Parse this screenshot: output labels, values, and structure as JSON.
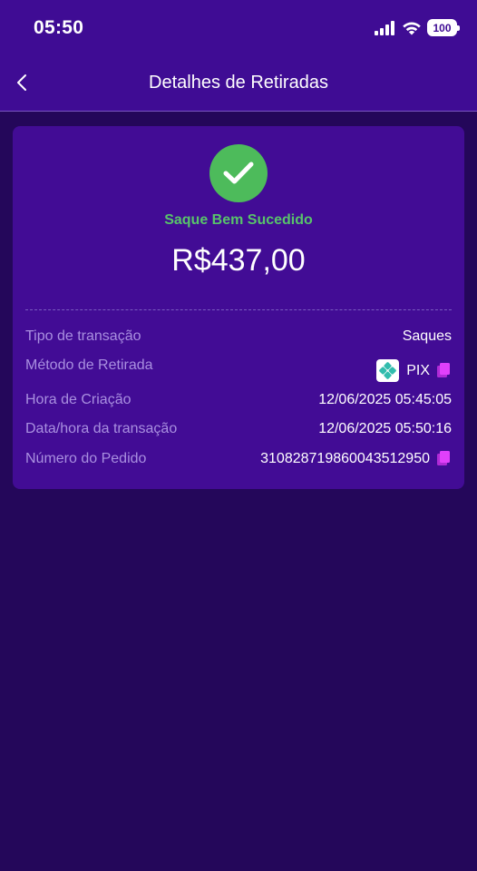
{
  "status_bar": {
    "time": "05:50",
    "battery": "100"
  },
  "nav": {
    "title": "Detalhes de Retiradas"
  },
  "card": {
    "status": "Saque Bem Sucedido",
    "amount": "R$437,00",
    "rows": [
      {
        "label": "Tipo de transação",
        "value": "Saques"
      },
      {
        "label": "Método de Retirada",
        "value": "PIX"
      },
      {
        "label": "Hora de Criação",
        "value": "12/06/2025 05:45:05"
      },
      {
        "label": "Data/hora da transação",
        "value": "12/06/2025 05:50:16"
      },
      {
        "label": "Número do Pedido",
        "value": "310828719860043512950"
      }
    ]
  },
  "colors": {
    "header": "#3f0c94",
    "background": "#24075a",
    "card": "#420c95",
    "success": "#4dbb5b",
    "copy_icon": "#e040fb"
  },
  "icons": [
    "back-chevron-icon",
    "signal-icon",
    "wifi-icon",
    "battery-icon",
    "check-icon",
    "pix-icon",
    "copy-icon"
  ]
}
